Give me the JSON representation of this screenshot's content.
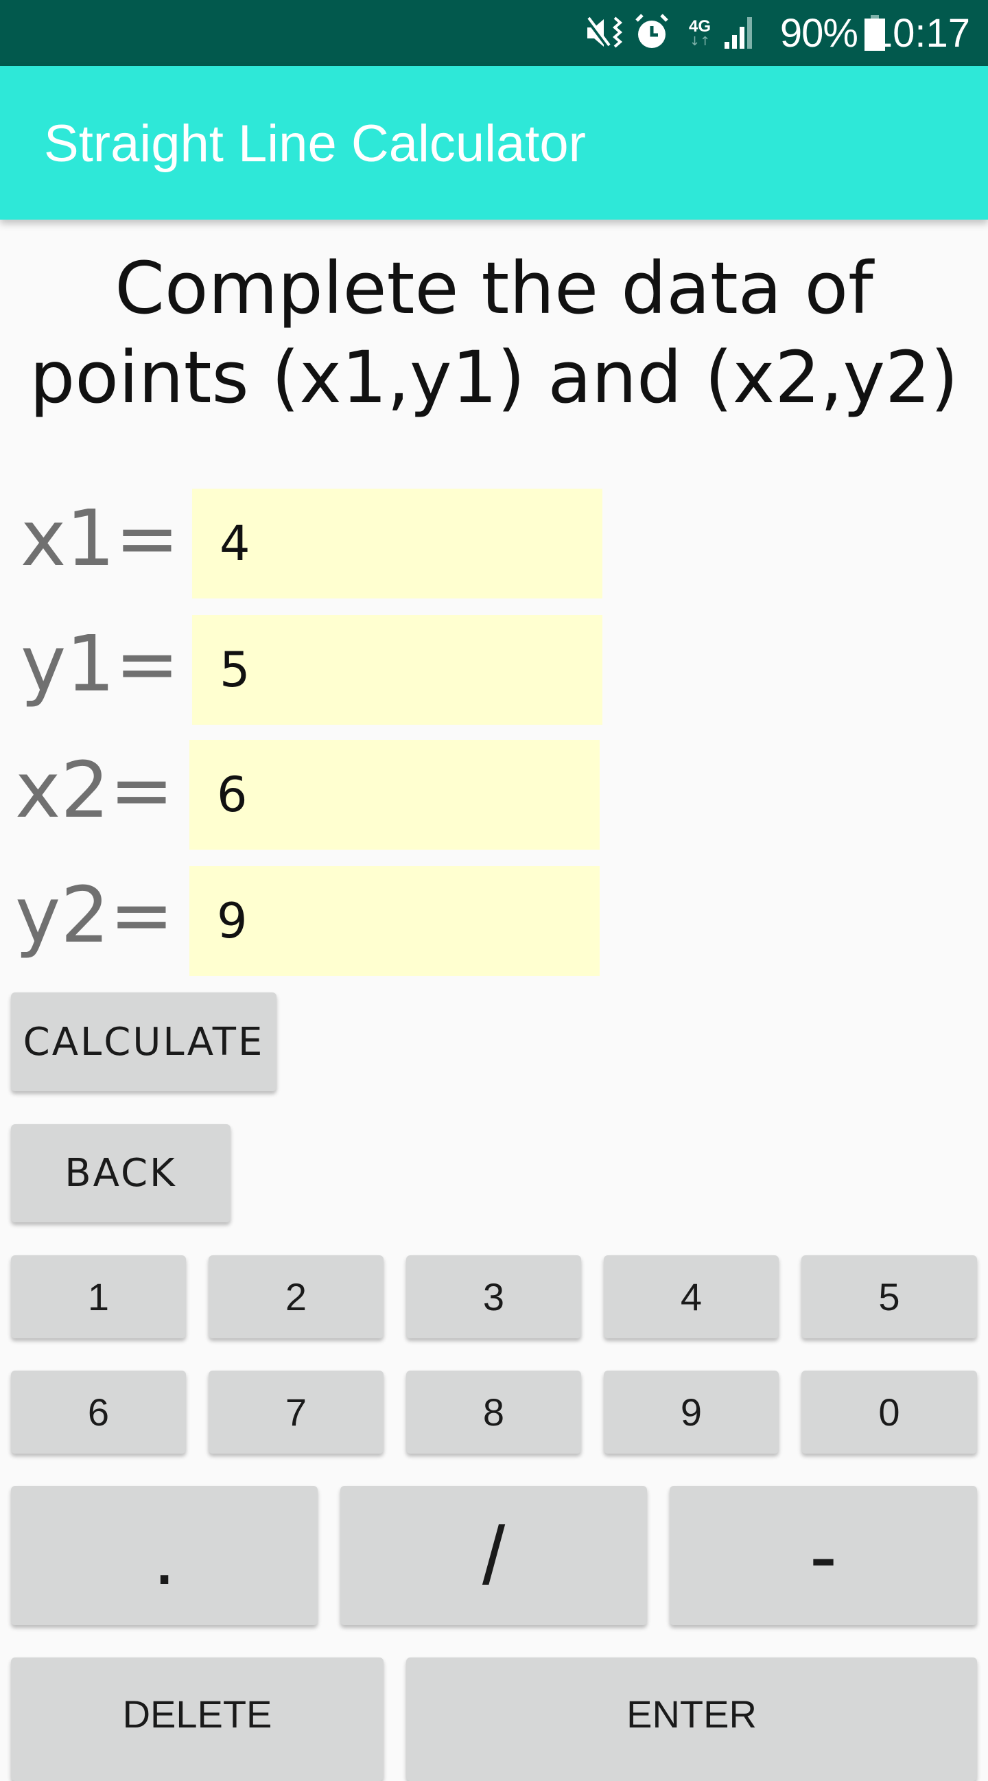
{
  "status_bar": {
    "icons": [
      "mute-vibrate-icon",
      "alarm-icon",
      "4g-data-icon",
      "signal-icon",
      "battery-icon"
    ],
    "network": "4G",
    "battery_percent": "90%",
    "time": "10:17"
  },
  "app_bar": {
    "title": "Straight Line Calculator"
  },
  "heading": {
    "line1": "Complete the data of",
    "line2": "points (x1,y1) and (x2,y2)"
  },
  "fields": [
    {
      "label": "x1=",
      "value": "4"
    },
    {
      "label": "y1=",
      "value": "5"
    },
    {
      "label": "x2=",
      "value": "6"
    },
    {
      "label": "y2=",
      "value": "9"
    }
  ],
  "buttons": {
    "calculate": "CALCULATE",
    "back": "BACK"
  },
  "keypad": {
    "row1": [
      "1",
      "2",
      "3",
      "4",
      "5"
    ],
    "row2": [
      "6",
      "7",
      "8",
      "9",
      "0"
    ],
    "row3": [
      ".",
      "/",
      "-"
    ],
    "row4": [
      "DELETE",
      "ENTER"
    ]
  },
  "colors": {
    "status_bar": "#02594d",
    "app_bar": "#2ee8d8",
    "field_bg": "#ffffd0",
    "button_bg": "#d6d7d7",
    "background": "#fafafa"
  }
}
